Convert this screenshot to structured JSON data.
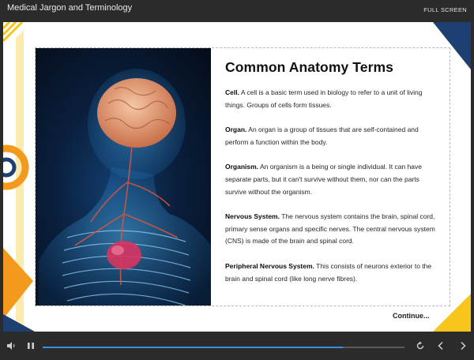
{
  "window": {
    "title": "Medical Jargon and Terminology",
    "fullscreen_label": "FULL SCREEN"
  },
  "slide": {
    "heading": "Common Anatomy Terms",
    "terms": [
      {
        "term": "Cell.",
        "definition": " A cell is a basic term used in biology to refer to a unit of living things. Groups of cells form tissues."
      },
      {
        "term": "Organ.",
        "definition": " An organ is a group of tissues that are self-contained and perform a function within the body."
      },
      {
        "term": "Organism.",
        "definition": " An organism is a being or single individual. It can have separate parts, but it can't survive without them, nor can the parts survive without the organism."
      },
      {
        "term": "Nervous System.",
        "definition": " The nervous system contains the brain, spinal cord, primary sense organs and specific nerves. The central nervous system (CNS) is made of the brain and spinal cord."
      },
      {
        "term": "Peripheral Nervous System.",
        "definition": " This consists of neurons exterior to the brain and spinal cord (like long nerve fibres)."
      }
    ],
    "continue_label": "Continue..."
  },
  "player": {
    "progress": 0.83,
    "icons": [
      "volume-icon",
      "pause-icon",
      "replay-icon",
      "prev-icon",
      "next-icon"
    ]
  },
  "colors": {
    "accent_orange": "#f39a1e",
    "accent_yellow": "#f7c51c",
    "accent_navy": "#1d3f72",
    "progress_blue": "#3d8fe0"
  }
}
